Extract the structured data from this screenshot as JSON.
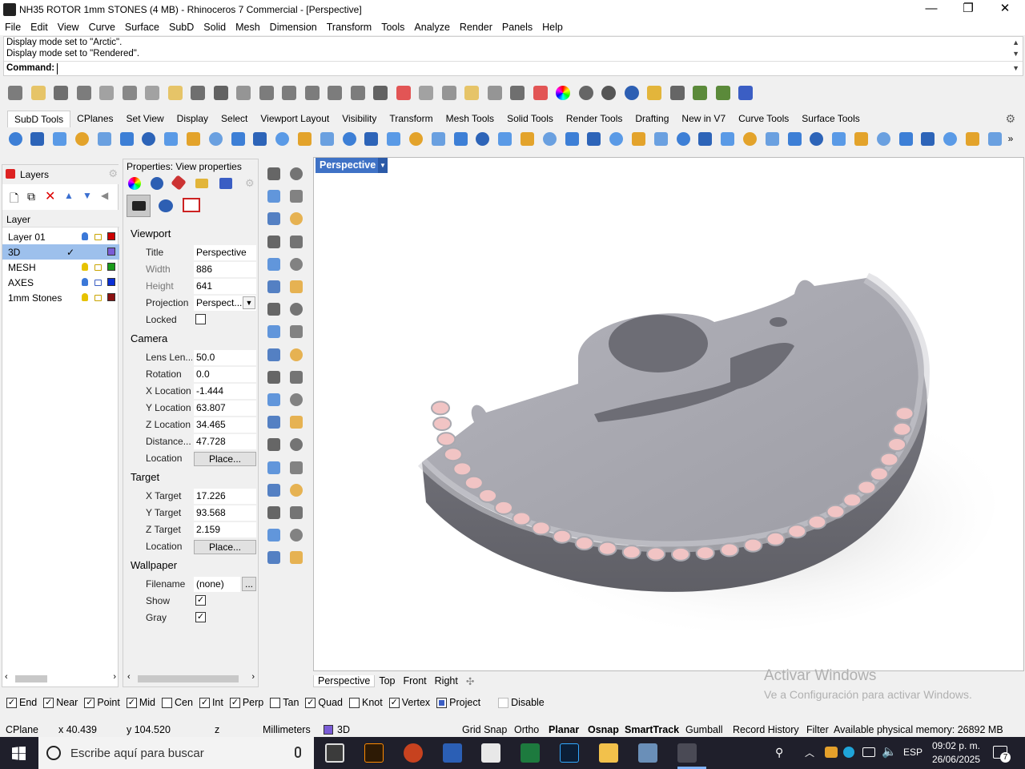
{
  "window": {
    "title": "NH35 ROTOR 1mm STONES (4 MB) - Rhinoceros 7 Commercial - [Perspective]",
    "minimize": "—",
    "maximize": "❐",
    "close": "✕"
  },
  "menu": [
    "File",
    "Edit",
    "View",
    "Curve",
    "Surface",
    "SubD",
    "Solid",
    "Mesh",
    "Dimension",
    "Transform",
    "Tools",
    "Analyze",
    "Render",
    "Panels",
    "Help"
  ],
  "command": {
    "history": [
      "Display mode set to \"Arctic\".",
      "Display mode set to \"Rendered\"."
    ],
    "prompt": "Command:",
    "value": ""
  },
  "tabs": [
    "SubD Tools",
    "CPlanes",
    "Set View",
    "Display",
    "Select",
    "Viewport Layout",
    "Visibility",
    "Transform",
    "Mesh Tools",
    "Solid Tools",
    "Render Tools",
    "Drafting",
    "New in V7",
    "Curve Tools",
    "Surface Tools"
  ],
  "layers": {
    "panel_title": "Layers",
    "column_header": "Layer",
    "rows": [
      {
        "name": "Layer 01",
        "color": "#cc0000",
        "current": false,
        "locked": false,
        "bulb": "#3b78d8"
      },
      {
        "name": "3D",
        "color": "#7a5cd6",
        "current": true,
        "locked": false,
        "bulb": ""
      },
      {
        "name": "MESH",
        "color": "#1a9b1a",
        "current": false,
        "locked": false,
        "bulb": "#e6c200"
      },
      {
        "name": "AXES",
        "color": "#0a2fd6",
        "current": false,
        "locked": true,
        "bulb": "#3b78d8"
      },
      {
        "name": "1mm Stones",
        "color": "#8b1010",
        "current": false,
        "locked": false,
        "bulb": "#e6c200"
      }
    ]
  },
  "properties": {
    "title": "Properties: View properties",
    "sections": {
      "viewport": "Viewport",
      "camera": "Camera",
      "target": "Target",
      "wallpaper": "Wallpaper"
    },
    "viewport": {
      "title_label": "Title",
      "title": "Perspective",
      "width_label": "Width",
      "width": "886",
      "height_label": "Height",
      "height": "641",
      "projection_label": "Projection",
      "projection": "Perspect...",
      "locked_label": "Locked",
      "locked": false
    },
    "camera": {
      "lens_label": "Lens Len...",
      "lens": "50.0",
      "rotation_label": "Rotation",
      "rotation": "0.0",
      "xloc_label": "X Location",
      "xloc": "-1.444",
      "yloc_label": "Y Location",
      "yloc": "63.807",
      "zloc_label": "Z Location",
      "zloc": "34.465",
      "dist_label": "Distance...",
      "dist": "47.728",
      "loc_label": "Location",
      "place": "Place..."
    },
    "target": {
      "x_label": "X Target",
      "x": "17.226",
      "y_label": "Y Target",
      "y": "93.568",
      "z_label": "Z Target",
      "z": "2.159",
      "loc_label": "Location",
      "place": "Place..."
    },
    "wallpaper": {
      "filename_label": "Filename",
      "filename": "(none)",
      "browse": "...",
      "show_label": "Show",
      "show": true,
      "gray_label": "Gray",
      "gray": true
    }
  },
  "viewport": {
    "active_tab": "Perspective",
    "tabs": [
      "Perspective",
      "Top",
      "Front",
      "Right"
    ],
    "add_tab": "✣"
  },
  "watermark": {
    "line1": "Activar Windows",
    "line2": "Ve a Configuración para activar Windows."
  },
  "osnaps": [
    {
      "label": "End",
      "on": true
    },
    {
      "label": "Near",
      "on": true
    },
    {
      "label": "Point",
      "on": true
    },
    {
      "label": "Mid",
      "on": true
    },
    {
      "label": "Cen",
      "on": false
    },
    {
      "label": "Int",
      "on": true
    },
    {
      "label": "Perp",
      "on": true
    },
    {
      "label": "Tan",
      "on": false
    },
    {
      "label": "Quad",
      "on": true
    },
    {
      "label": "Knot",
      "on": false
    },
    {
      "label": "Vertex",
      "on": true
    },
    {
      "label": "Project",
      "on": "partial"
    },
    {
      "label": "Disable",
      "on": false
    }
  ],
  "status": {
    "cplane": "CPlane",
    "x": "x 40.439",
    "y": "y 104.520",
    "z": "z",
    "units": "Millimeters",
    "layer": "3D",
    "gridsnap": "Grid Snap",
    "ortho": "Ortho",
    "planar": "Planar",
    "osnap": "Osnap",
    "smarttrack": "SmartTrack",
    "gumball": "Gumball",
    "history": "Record History",
    "filter": "Filter",
    "memory": "Available physical memory: 26892 MB"
  },
  "taskbar": {
    "search_placeholder": "Escribe aquí para buscar",
    "lang": "ESP",
    "time": "09:02 p. m.",
    "date": "26/06/2025",
    "notifications": "7"
  }
}
